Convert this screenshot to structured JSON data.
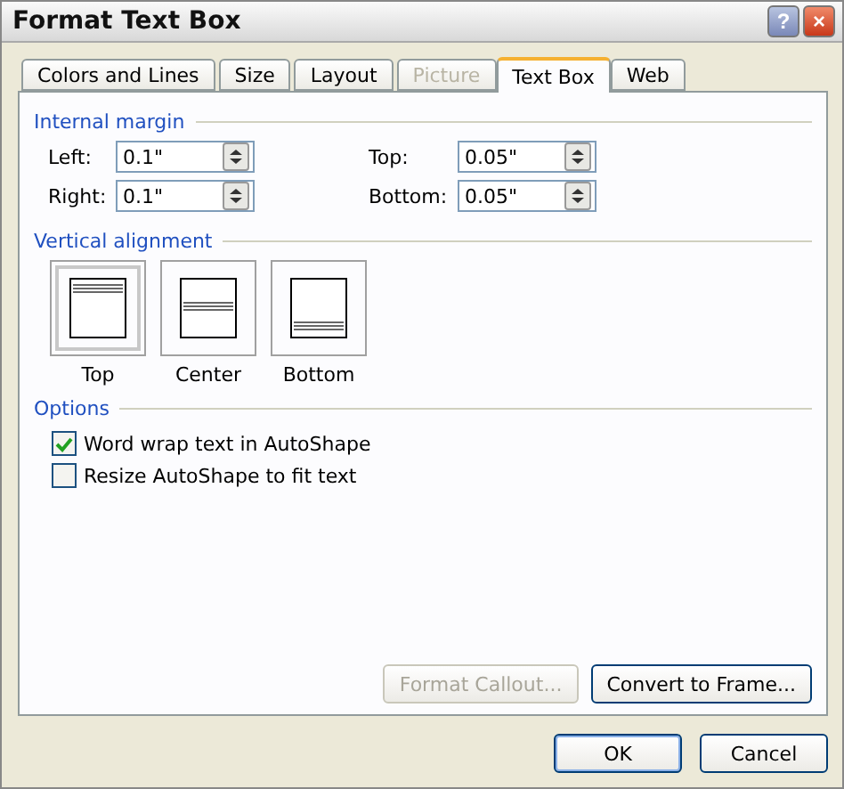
{
  "window": {
    "title": "Format Text Box",
    "help": "?",
    "close": "×"
  },
  "tabs": [
    {
      "label": "Colors and Lines",
      "selected": false,
      "disabled": false
    },
    {
      "label": "Size",
      "selected": false,
      "disabled": false
    },
    {
      "label": "Layout",
      "selected": false,
      "disabled": false
    },
    {
      "label": "Picture",
      "selected": false,
      "disabled": true
    },
    {
      "label": "Text Box",
      "selected": true,
      "disabled": false
    },
    {
      "label": "Web",
      "selected": false,
      "disabled": false
    }
  ],
  "internal_margin": {
    "title": "Internal margin",
    "fields": [
      {
        "label": "Left:",
        "value": "0.1\""
      },
      {
        "label": "Top:",
        "value": "0.05\""
      },
      {
        "label": "Right:",
        "value": "0.1\""
      },
      {
        "label": "Bottom:",
        "value": "0.05\""
      }
    ]
  },
  "vertical_alignment": {
    "title": "Vertical alignment",
    "options": [
      {
        "label": "Top",
        "kind": "top",
        "selected": true
      },
      {
        "label": "Center",
        "kind": "center",
        "selected": false
      },
      {
        "label": "Bottom",
        "kind": "bottom",
        "selected": false
      }
    ]
  },
  "options": {
    "title": "Options",
    "checkboxes": [
      {
        "label": "Word wrap text in AutoShape",
        "checked": true
      },
      {
        "label": "Resize AutoShape to fit text",
        "checked": false
      }
    ]
  },
  "panel_buttons": [
    {
      "label": "Format Callout...",
      "disabled": true
    },
    {
      "label": "Convert to Frame...",
      "disabled": false
    }
  ],
  "dialog_buttons": [
    {
      "label": "OK",
      "default": true
    },
    {
      "label": "Cancel",
      "default": false
    }
  ]
}
